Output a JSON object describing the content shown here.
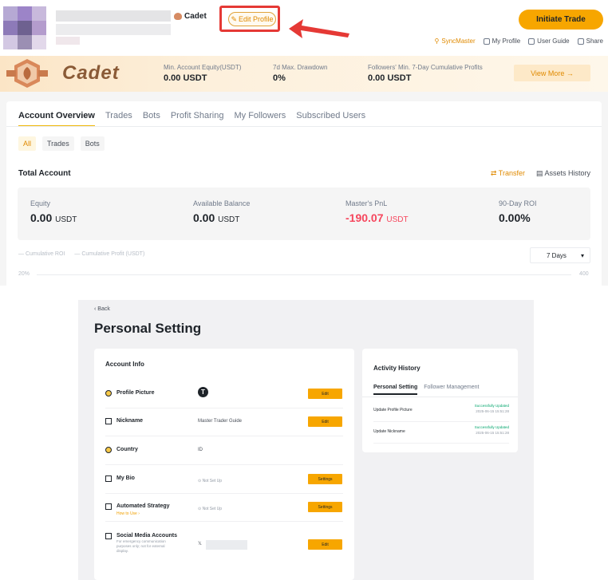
{
  "header": {
    "level_name": "Cadet",
    "edit_profile": "Edit Profile",
    "initiate_trade": "Initiate Trade",
    "links": [
      "SyncMaster",
      "My Profile",
      "User Guide",
      "Share"
    ]
  },
  "banner": {
    "title": "Cadet",
    "stats": [
      {
        "label": "Min. Account Equity(USDT)",
        "value": "0.00 USDT"
      },
      {
        "label": "7d Max. Drawdown",
        "value": "0%"
      },
      {
        "label": "Followers' Min. 7-Day Cumulative Profits",
        "value": "0.00 USDT"
      }
    ],
    "view_more": "View More →"
  },
  "tabs": [
    "Account Overview",
    "Trades",
    "Bots",
    "Profit Sharing",
    "My Followers",
    "Subscribed Users"
  ],
  "subtabs": [
    "All",
    "Trades",
    "Bots"
  ],
  "total_account": {
    "title": "Total Account",
    "transfer": "Transfer",
    "assets_history": "Assets History",
    "stats": [
      {
        "label": "Equity",
        "value": "0.00",
        "unit": "USDT"
      },
      {
        "label": "Available Balance",
        "value": "0.00",
        "unit": "USDT"
      },
      {
        "label": "Master's PnL",
        "value": "-190.07",
        "unit": "USDT"
      },
      {
        "label": "90-Day ROI",
        "value": "0.00%",
        "unit": ""
      }
    ]
  },
  "chart": {
    "legend": [
      "Cumulative ROI",
      "Cumulative Profit (USDT)"
    ],
    "period": "7 Days",
    "left_tick": "20%",
    "right_tick": "400"
  },
  "settings": {
    "back": "‹ Back",
    "title": "Personal Setting",
    "account_info": "Account Info",
    "rows": {
      "picture": {
        "label": "Profile Picture",
        "button": "Edit"
      },
      "nickname": {
        "label": "Nickname",
        "value": "Master Trader Guide",
        "button": "Edit"
      },
      "country": {
        "label": "Country",
        "value": "ID"
      },
      "bio": {
        "label": "My Bio",
        "value": "⊙ Not Set Up",
        "button": "Settings"
      },
      "strategy": {
        "label": "Automated Strategy",
        "sub": "How to Use ›",
        "value": "⊙ Not Set Up",
        "button": "Settings"
      },
      "social": {
        "label": "Social Media Accounts",
        "desc": "For emergency communication purposes only; not for external display.",
        "value": "𝕏",
        "button": "Edit"
      }
    },
    "activity": {
      "title": "Activity History",
      "tabs": [
        "Personal Setting",
        "Follower Management"
      ],
      "items": [
        {
          "text": "Update Profile Picture",
          "status": "Successfully Updated",
          "date": "2025-06-15 15:51:28"
        },
        {
          "text": "Update Nickname",
          "status": "Successfully Updated",
          "date": "2025-06-15 15:51:28"
        }
      ]
    }
  }
}
